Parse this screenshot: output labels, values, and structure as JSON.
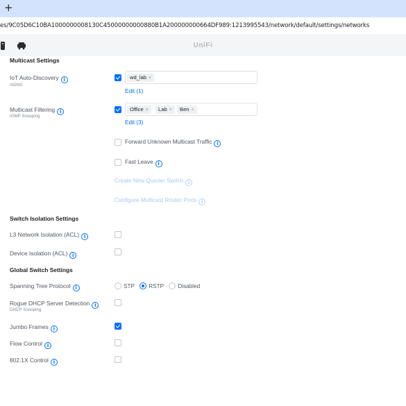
{
  "browser": {
    "new_tab_label": "+",
    "url": "es/9C05D6C10BA1000000008130C45000000000880B1A200000000664DF989:1213995543/network/default/settings/networks"
  },
  "app": {
    "brand": "UniFi"
  },
  "multicast": {
    "section_title": "Multicast Settings",
    "iot_auto_discovery": {
      "label": "IoT Auto-Discovery",
      "sublabel": "mDNS",
      "checked": true,
      "tags": [
        "wd_lab"
      ],
      "edit_label": "Edit (1)"
    },
    "multicast_filtering": {
      "label": "Multicast Filtering",
      "sublabel": "IGMP Snooping",
      "checked": true,
      "tags": [
        "Office",
        "Lab",
        "Ben"
      ],
      "edit_label": "Edit (3)"
    },
    "forward_unknown": {
      "label": "Forward Unknown Multicast Traffic",
      "checked": false
    },
    "fast_leave": {
      "label": "Fast Leave",
      "checked": false
    },
    "create_querier": "Create New Querier Switch",
    "configure_router_ports": "Configure Multicast Router Ports"
  },
  "switch_isolation": {
    "section_title": "Switch Isolation Settings",
    "l3_isolation": {
      "label": "L3 Network Isolation (ACL)",
      "checked": false
    },
    "device_isolation": {
      "label": "Device Isolation (ACL)",
      "checked": false
    }
  },
  "global_switch": {
    "section_title": "Global Switch Settings",
    "spanning_tree": {
      "label": "Spanning Tree Protocol",
      "options": [
        "STP",
        "RSTP",
        "Disabled"
      ],
      "selected": "RSTP"
    },
    "rogue_dhcp": {
      "label": "Rogue DHCP Server Detection",
      "sublabel": "DHCP Snooping",
      "checked": false
    },
    "jumbo_frames": {
      "label": "Jumbo Frames",
      "checked": true
    },
    "flow_control": {
      "label": "Flow Control",
      "checked": false
    },
    "dot1x_control": {
      "label": "802.1X Control",
      "checked": false
    }
  },
  "icons": {
    "info": "info-icon",
    "tag_remove": "×",
    "info_glyph": "i"
  },
  "colors": {
    "accent": "#006fff",
    "tab_bar": "#d3e3fd",
    "header_bg": "#f4f5f6"
  }
}
